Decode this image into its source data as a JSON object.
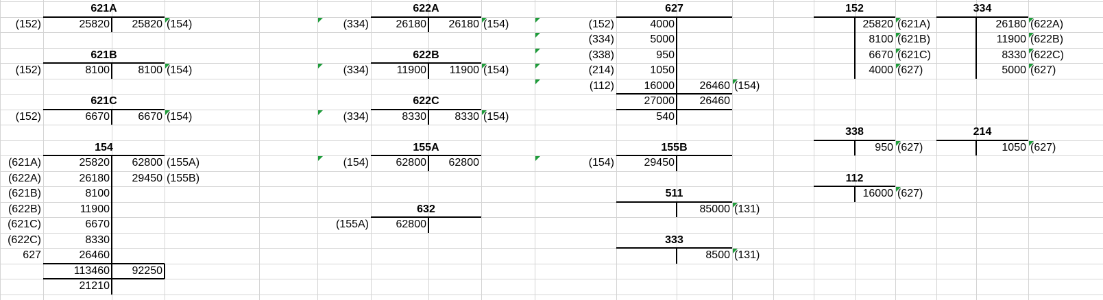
{
  "accounts": {
    "a621A": {
      "title": "621A",
      "ref": "(152)",
      "debit": "25820",
      "credit": "25820",
      "cref": "(154)"
    },
    "a621B": {
      "title": "621B",
      "ref": "(152)",
      "debit": "8100",
      "credit": "8100",
      "cref": "(154)"
    },
    "a621C": {
      "title": "621C",
      "ref": "(152)",
      "debit": "6670",
      "credit": "6670",
      "cref": "(154)"
    },
    "a622A": {
      "title": "622A",
      "ref": "(334)",
      "debit": "26180",
      "credit": "26180",
      "cref": "(154)"
    },
    "a622B": {
      "title": "622B",
      "ref": "(334)",
      "debit": "11900",
      "credit": "11900",
      "cref": "(154)"
    },
    "a622C": {
      "title": "622C",
      "ref": "(334)",
      "debit": "8330",
      "credit": "8330",
      "cref": "(154)"
    },
    "a155A": {
      "title": "155A",
      "ref": "(154)",
      "debit": "62800",
      "credit": "62800"
    },
    "a632": {
      "title": "632",
      "ref": "(155A)",
      "debit": "62800"
    },
    "a155B": {
      "title": "155B",
      "ref": "(154)",
      "debit": "29450"
    },
    "a511": {
      "title": "511",
      "credit": "85000",
      "cref": "(131)"
    },
    "a333": {
      "title": "333",
      "credit": "8500",
      "cref": "(131)"
    },
    "a338": {
      "title": "338",
      "credit": "950",
      "cref": "(627)"
    },
    "a214": {
      "title": "214",
      "credit": "1050",
      "cref": "(627)"
    },
    "a112": {
      "title": "112",
      "credit": "16000",
      "cref": "(627)"
    },
    "a154": {
      "title": "154",
      "debits": [
        {
          "ref": "(621A)",
          "value": "25820"
        },
        {
          "ref": "(622A)",
          "value": "26180"
        },
        {
          "ref": "(621B)",
          "value": "8100"
        },
        {
          "ref": "(622B)",
          "value": "11900"
        },
        {
          "ref": "(621C)",
          "value": "6670"
        },
        {
          "ref": "(622C)",
          "value": "8330"
        },
        {
          "ref": "627",
          "value": "26460"
        }
      ],
      "credits": [
        {
          "value": "62800",
          "ref": "(155A)"
        },
        {
          "value": "29450",
          "ref": "(155B)"
        }
      ],
      "total_debit": "113460",
      "total_credit": "92250",
      "balance": "21210"
    },
    "a627": {
      "title": "627",
      "debits": [
        {
          "ref": "(152)",
          "value": "4000"
        },
        {
          "ref": "(334)",
          "value": "5000"
        },
        {
          "ref": "(338)",
          "value": "950"
        },
        {
          "ref": "(214)",
          "value": "1050"
        },
        {
          "ref": "(112)",
          "value": "16000"
        }
      ],
      "credit": "26460",
      "cref": "(154)",
      "total_debit": "27000",
      "total_credit": "26460",
      "balance": "540"
    },
    "a152": {
      "title": "152",
      "credits": [
        {
          "value": "25820",
          "ref": "(621A)"
        },
        {
          "value": "8100",
          "ref": "(621B)"
        },
        {
          "value": "6670",
          "ref": "(621C)"
        },
        {
          "value": "4000",
          "ref": "(627)"
        }
      ]
    },
    "a334": {
      "title": "334",
      "credits": [
        {
          "value": "26180",
          "ref": "(622A)"
        },
        {
          "value": "11900",
          "ref": "(622B)"
        },
        {
          "value": "8330",
          "ref": "(622C)"
        },
        {
          "value": "5000",
          "ref": "(627)"
        }
      ]
    }
  }
}
